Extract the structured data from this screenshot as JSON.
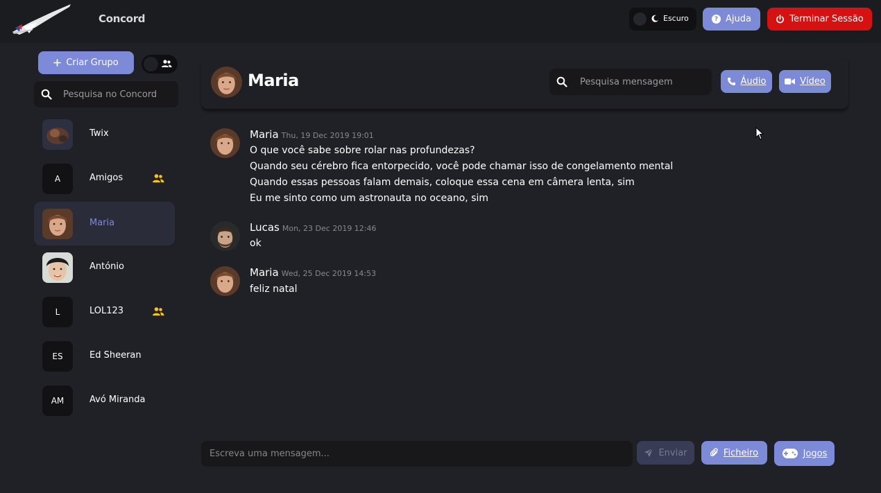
{
  "app": {
    "title": "Concord"
  },
  "topbar": {
    "theme_label": "Escuro",
    "help_label": "Ajuda",
    "logout_label": "Terminar Sessão",
    "colors": {
      "accent": "#7d8ad8",
      "danger": "#d41212"
    }
  },
  "sidebar": {
    "create_group_label": "Criar Grupo",
    "search_placeholder": "Pesquisa no Concord",
    "contacts": [
      {
        "name": "Twix",
        "initials": "",
        "is_group": false,
        "active": false,
        "avatar": "photo"
      },
      {
        "name": "Amigos",
        "initials": "A",
        "is_group": true,
        "active": false,
        "avatar": "initials"
      },
      {
        "name": "Maria",
        "initials": "",
        "is_group": false,
        "active": true,
        "avatar": "photo"
      },
      {
        "name": "António",
        "initials": "",
        "is_group": false,
        "active": false,
        "avatar": "photo"
      },
      {
        "name": "LOL123",
        "initials": "L",
        "is_group": true,
        "active": false,
        "avatar": "initials"
      },
      {
        "name": "Ed Sheeran",
        "initials": "ES",
        "is_group": false,
        "active": false,
        "avatar": "initials"
      },
      {
        "name": "Avó Miranda",
        "initials": "AM",
        "is_group": false,
        "active": false,
        "avatar": "initials"
      }
    ]
  },
  "chat": {
    "title": "Maria",
    "search_placeholder": "Pesquisa mensagem",
    "audio_label": "Áudio",
    "video_label": "Vídeo",
    "messages": [
      {
        "author": "Maria",
        "timestamp": "Thu, 19 Dec 2019 19:01",
        "lines": [
          "O que você sabe sobre rolar nas profundezas?",
          "Quando seu cérebro fica entorpecido, você pode chamar isso de congelamento mental",
          "Quando essas pessoas falam demais, coloque essa cena em câmera lenta, sim",
          "Eu me sinto como um astronauta no oceano, sim"
        ]
      },
      {
        "author": "Lucas",
        "timestamp": "Mon, 23 Dec 2019 12:46",
        "lines": [
          "ok"
        ]
      },
      {
        "author": "Maria",
        "timestamp": "Wed, 25 Dec 2019 14:53",
        "lines": [
          "feliz natal"
        ]
      }
    ]
  },
  "composer": {
    "placeholder": "Escreva uma mensagem...",
    "send_label": "Enviar",
    "file_label": "Ficheiro",
    "games_label": "Jogos"
  }
}
